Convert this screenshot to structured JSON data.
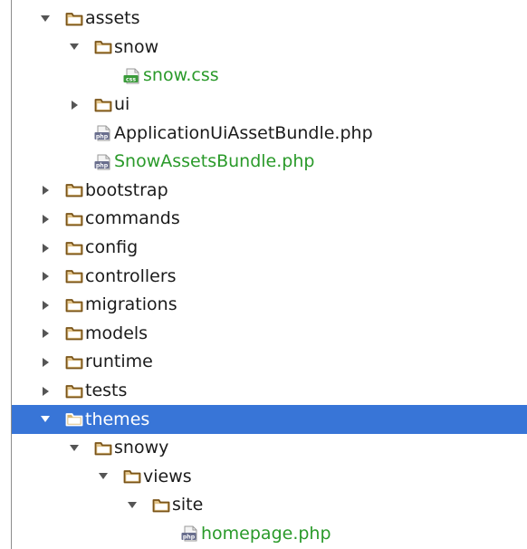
{
  "project_tree": {
    "items": [
      {
        "name": "tree-node-assets",
        "label": "assets",
        "kind": "folder",
        "expanded": true,
        "depth": 1
      },
      {
        "name": "tree-node-snow",
        "label": "snow",
        "kind": "folder",
        "expanded": true,
        "depth": 2
      },
      {
        "name": "tree-node-snow-css",
        "label": "snow.css",
        "kind": "css",
        "depth": 3,
        "vcs_status": "added"
      },
      {
        "name": "tree-node-ui",
        "label": "ui",
        "kind": "folder",
        "expanded": false,
        "depth": 2
      },
      {
        "name": "tree-node-application-ui-asset-bundle",
        "label": "ApplicationUiAssetBundle.php",
        "kind": "php",
        "depth": 2
      },
      {
        "name": "tree-node-snow-assets-bundle",
        "label": "SnowAssetsBundle.php",
        "kind": "php",
        "depth": 2,
        "vcs_status": "added"
      },
      {
        "name": "tree-node-bootstrap",
        "label": "bootstrap",
        "kind": "folder",
        "expanded": false,
        "depth": 1
      },
      {
        "name": "tree-node-commands",
        "label": "commands",
        "kind": "folder",
        "expanded": false,
        "depth": 1
      },
      {
        "name": "tree-node-config",
        "label": "config",
        "kind": "folder",
        "expanded": false,
        "depth": 1
      },
      {
        "name": "tree-node-controllers",
        "label": "controllers",
        "kind": "folder",
        "expanded": false,
        "depth": 1
      },
      {
        "name": "tree-node-migrations",
        "label": "migrations",
        "kind": "folder",
        "expanded": false,
        "depth": 1
      },
      {
        "name": "tree-node-models",
        "label": "models",
        "kind": "folder",
        "expanded": false,
        "depth": 1
      },
      {
        "name": "tree-node-runtime",
        "label": "runtime",
        "kind": "folder",
        "expanded": false,
        "depth": 1
      },
      {
        "name": "tree-node-tests",
        "label": "tests",
        "kind": "folder",
        "expanded": false,
        "depth": 1
      },
      {
        "name": "tree-node-themes",
        "label": "themes",
        "kind": "folder",
        "expanded": true,
        "depth": 1,
        "selected": true
      },
      {
        "name": "tree-node-snowy",
        "label": "snowy",
        "kind": "folder",
        "expanded": true,
        "depth": 2
      },
      {
        "name": "tree-node-views",
        "label": "views",
        "kind": "folder",
        "expanded": true,
        "depth": 3
      },
      {
        "name": "tree-node-site",
        "label": "site",
        "kind": "folder",
        "expanded": true,
        "depth": 4
      },
      {
        "name": "tree-node-homepage",
        "label": "homepage.php",
        "kind": "php",
        "depth": 5,
        "vcs_status": "added"
      }
    ]
  },
  "icons": {
    "css_badge": "css",
    "php_badge": "php"
  },
  "colors": {
    "selection_background": "#3875d7",
    "selection_text": "#ffffff",
    "default_text": "#1b1b1b",
    "added_file_text": "#2a9a2a",
    "folder_outline": "#7a5418",
    "folder_fill": "#e2c48a",
    "expander_arrow": "#555555"
  }
}
